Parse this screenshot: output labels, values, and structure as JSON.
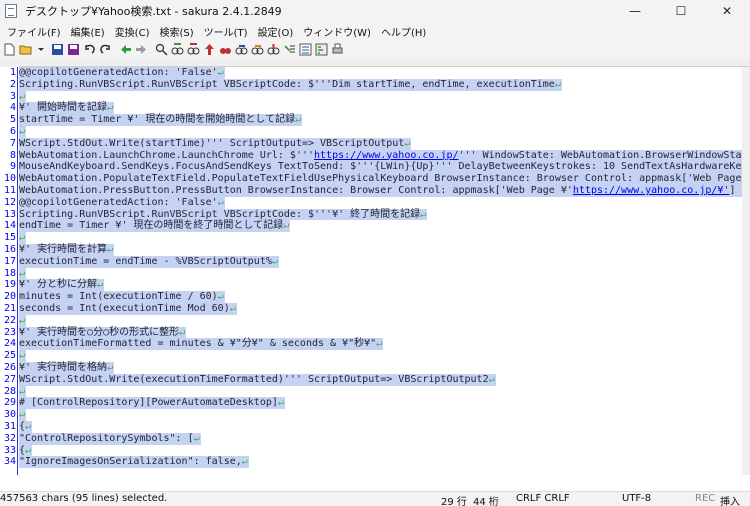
{
  "window": {
    "title": "デスクトップ¥Yahoo検索.txt - sakura 2.4.1.2849",
    "minimize": "—",
    "maximize": "☐",
    "close": "✕"
  },
  "menu": [
    "ファイル(F)",
    "編集(E)",
    "変換(C)",
    "検索(S)",
    "ツール(T)",
    "設定(O)",
    "ウィンドウ(W)",
    "ヘルプ(H)"
  ],
  "toolbar_icons": [
    "new-file-icon",
    "open-folder-icon",
    "save-icon",
    "save-as-icon",
    "undo-icon",
    "redo-icon",
    "jump-back-icon",
    "jump-forward-icon",
    "search-icon",
    "search-prev-icon",
    "search-next-icon",
    "replace-icon",
    "bookmark-icon",
    "grep-icon",
    "outline-icon",
    "compare-icon",
    "settings-icon"
  ],
  "editor": {
    "eol_mark": "↵",
    "lines": [
      {
        "n": "1",
        "text": "@@copilotGeneratedAction: 'False'"
      },
      {
        "n": "2",
        "text": "Scripting.RunVBScript.RunVBScript VBScriptCode: $'''Dim startTime, endTime, executionTime"
      },
      {
        "n": "3",
        "text": ""
      },
      {
        "n": "4",
        "text": "¥' 開始時間を記録"
      },
      {
        "n": "5",
        "text": "startTime = Timer ¥' 現在の時間を開始時間として記録"
      },
      {
        "n": "6",
        "text": ""
      },
      {
        "n": "7",
        "text": "WScript.StdOut.Write(startTime)''' ScriptOutput=> VBScriptOutput"
      },
      {
        "n": "8",
        "text": "WebAutomation.LaunchChrome.LaunchChrome Url: $'''",
        "url": "https://www.yahoo.co.jp/",
        "after": "''' WindowState: WebAutomation.BrowserWindowSta",
        "full": true
      },
      {
        "n": "9",
        "text": "MouseAndKeyboard.SendKeys.FocusAndSendKeys TextToSend: $'''{LWin}{Up}''' DelayBetweenKeystrokes: 10 SendTextAsHardwareKe",
        "full": true
      },
      {
        "n": "10",
        "text": "WebAutomation.PopulateTextField.PopulateTextFieldUsePhysicalKeyboard BrowserInstance: Browser Control: appmask['Web Page",
        "full": true
      },
      {
        "n": "11",
        "text": "WebAutomation.PressButton.PressButton BrowserInstance: Browser Control: appmask['Web Page ¥'",
        "url": "https://www.yahoo.co.jp/¥'",
        "after": "]",
        "full": true
      },
      {
        "n": "12",
        "text": "@@copilotGeneratedAction: 'False'"
      },
      {
        "n": "13",
        "text": "Scripting.RunVBScript.RunVBScript VBScriptCode: $'''¥' 終了時間を記録"
      },
      {
        "n": "14",
        "text": "endTime = Timer ¥' 現在の時間を終了時間として記録"
      },
      {
        "n": "15",
        "text": ""
      },
      {
        "n": "16",
        "text": "¥' 実行時間を計算"
      },
      {
        "n": "17",
        "text": "executionTime = endTime - %VBScriptOutput%"
      },
      {
        "n": "18",
        "text": ""
      },
      {
        "n": "19",
        "text": "¥' 分と秒に分解"
      },
      {
        "n": "20",
        "text": "minutes = Int(executionTime / 60)"
      },
      {
        "n": "21",
        "text": "seconds = Int(executionTime Mod 60)"
      },
      {
        "n": "22",
        "text": ""
      },
      {
        "n": "23",
        "text": "¥' 実行時間を○分○秒の形式に整形"
      },
      {
        "n": "24",
        "text": "executionTimeFormatted = minutes & ¥\"分¥\" & seconds & ¥\"秒¥\""
      },
      {
        "n": "25",
        "text": ""
      },
      {
        "n": "26",
        "text": "¥' 実行時間を格納"
      },
      {
        "n": "27",
        "text": "WScript.StdOut.Write(executionTimeFormatted)''' ScriptOutput=> VBScriptOutput2"
      },
      {
        "n": "28",
        "text": ""
      },
      {
        "n": "29",
        "text": "# [ControlRepository][PowerAutomateDesktop]"
      },
      {
        "n": "30",
        "text": ""
      },
      {
        "n": "31",
        "text": "{"
      },
      {
        "n": "32",
        "text": "  \"ControlRepositorySymbols\": ["
      },
      {
        "n": "33",
        "text": "    {"
      },
      {
        "n": "34",
        "text": "      \"IgnoreImagesOnSerialization\": false,"
      }
    ]
  },
  "status": {
    "selection": "457563 chars (95 lines) selected.",
    "line": "29 行",
    "column": "44 桁",
    "eol": "CRLF CRLF",
    "encoding": "UTF-8",
    "rec": "REC",
    "insert": "挿入"
  }
}
